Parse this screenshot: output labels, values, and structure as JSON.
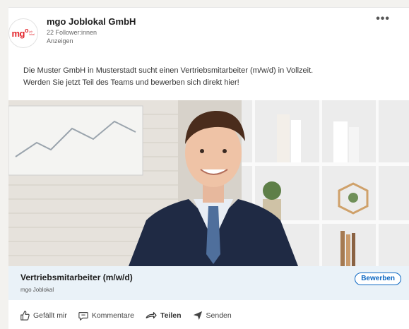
{
  "post": {
    "company_name": "mgo Joblokal GmbH",
    "followers": "22 Follower:innen",
    "promoted_label": "Anzeigen",
    "logo_text": "mg",
    "logo_superscript": "o",
    "logo_subtext": "job lokal",
    "more_label": "•••",
    "body_line1": "Die Muster GmbH in Musterstadt sucht einen Vertriebsmitarbeiter (m/w/d) in Vollzeit.",
    "body_line2": "Werden Sie jetzt Teil des Teams und bewerben sich direkt hier!"
  },
  "job": {
    "title": "Vertriebsmitarbeiter (m/w/d)",
    "company": "mgo Joblokal",
    "apply_label": "Bewerben"
  },
  "actions": [
    {
      "label": "Gefällt mir",
      "icon": "thumbs-up-icon"
    },
    {
      "label": "Kommentare",
      "icon": "comment-icon"
    },
    {
      "label": "Teilen",
      "icon": "share-icon"
    },
    {
      "label": "Senden",
      "icon": "send-icon"
    }
  ],
  "colors": {
    "brand_red": "#e3242b",
    "link_blue": "#0a66c2",
    "job_bar_bg": "#eaf2f8"
  }
}
